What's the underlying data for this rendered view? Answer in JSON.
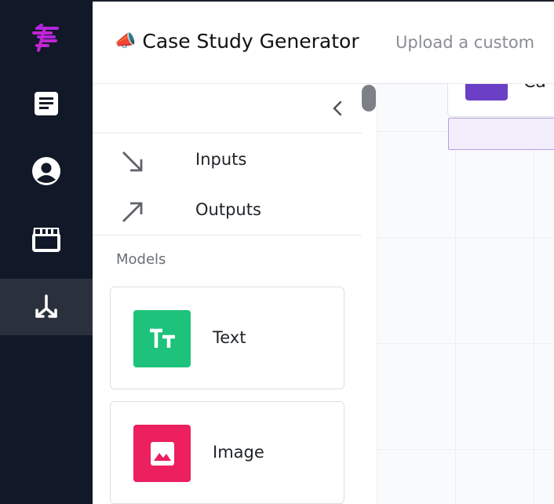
{
  "app": {
    "title_emoji": "📣",
    "title": "Case Study Generator",
    "subtitle": "Upload a custom"
  },
  "nav": {
    "items": [
      {
        "icon": "logo-icon"
      },
      {
        "icon": "document-icon"
      },
      {
        "icon": "user-icon"
      },
      {
        "icon": "store-icon"
      },
      {
        "icon": "workflow-icon",
        "active": true
      }
    ]
  },
  "panel": {
    "io": [
      {
        "label": "Inputs",
        "icon": "arrow-down-right-icon"
      },
      {
        "label": "Outputs",
        "icon": "arrow-up-right-icon"
      }
    ],
    "section_label": "Models",
    "models": [
      {
        "label": "Text",
        "icon": "text-icon",
        "color": "#1ec27a"
      },
      {
        "label": "Image",
        "icon": "image-icon",
        "color": "#ec1f5f"
      }
    ]
  },
  "canvas": {
    "node_label": "Ca"
  },
  "colors": {
    "rail": "#111827",
    "rail_active": "#2b303d",
    "brand": "#c026d3",
    "node_accent": "#6b3fc6"
  }
}
